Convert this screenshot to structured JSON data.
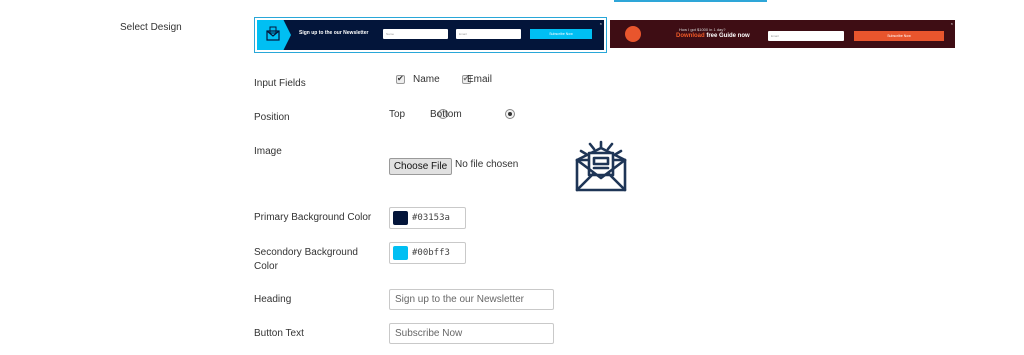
{
  "labels": {
    "select_design": "Select Design",
    "input_fields": "Input Fields",
    "position": "Position",
    "image": "Image",
    "primary_bg": "Primary Background Color",
    "secondary_bg_line1": "Secondory Background",
    "secondary_bg_line2": "Color",
    "heading": "Heading",
    "button_text": "Button Text"
  },
  "designs": {
    "design1": {
      "text": "Sign up to the our Newsletter",
      "field1": "Name",
      "field2": "Email",
      "button": "Subscribe Now",
      "close": "×"
    },
    "design2": {
      "line1": "How I got $1000 in 1 day?",
      "line2_accent": "Download",
      "line2_rest": " free Guide now",
      "field1": "Email",
      "button": "Subscribe Now",
      "close": "×"
    }
  },
  "input_fields": {
    "name_label": "Name",
    "name_checked": true,
    "email_label": "Email",
    "email_checked": true
  },
  "position": {
    "top_label": "Top",
    "bottom_label": "Bottom",
    "selected": "Bottom"
  },
  "image": {
    "button_label": "Choose File",
    "status": "No file chosen",
    "preview_icon": "newsletter-envelope-icon"
  },
  "colors": {
    "primary": "#03153a",
    "secondary": "#00bff3"
  },
  "heading_value": "Sign up to the our Newsletter",
  "button_text_value": "Subscribe Now",
  "accent_border": "#29a7d8"
}
